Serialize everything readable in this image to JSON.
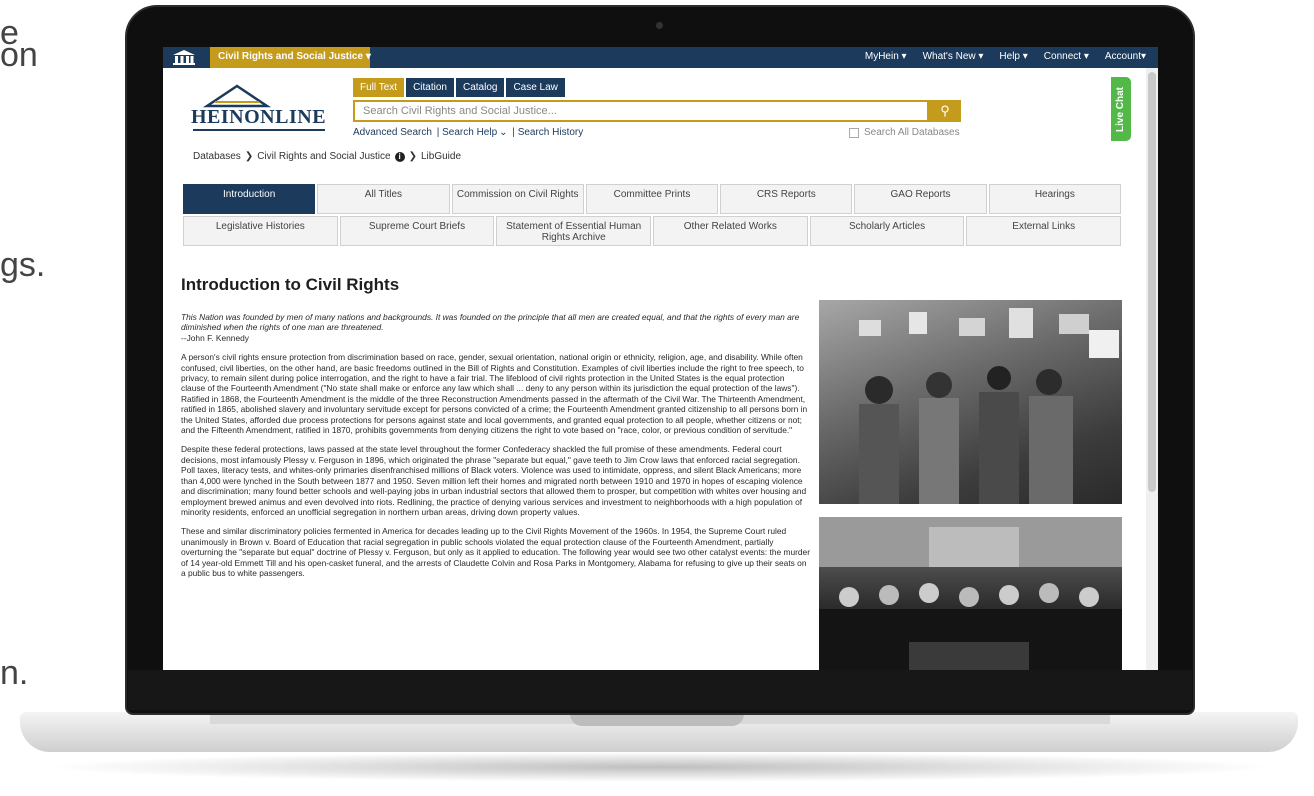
{
  "background_text": [
    "e",
    "on",
    "gs.",
    "n."
  ],
  "app": {
    "topbar": {
      "database_menu": "Civil Rights and Social Justice",
      "nav": [
        "MyHein ▾",
        "What's New ▾",
        "Help ▾",
        "Connect ▾",
        "Account▾"
      ]
    },
    "logo": "HEINONLINE",
    "search": {
      "tabs": [
        "Full Text",
        "Citation",
        "Catalog",
        "Case Law"
      ],
      "placeholder": "Search Civil Rights and Social Justice...",
      "advanced": "Advanced Search",
      "help": "Search Help",
      "history": "Search History",
      "all_databases": "Search All Databases"
    },
    "live_chat": "Live Chat",
    "breadcrumb": [
      "Databases",
      "Civil Rights and Social Justice",
      "LibGuide"
    ],
    "nav_buttons": {
      "row1": [
        "Introduction",
        "All Titles",
        "Commission on Civil Rights",
        "Committee Prints",
        "CRS Reports",
        "GAO Reports",
        "Hearings"
      ],
      "row2": [
        "Legislative Histories",
        "Supreme Court Briefs",
        "Statement of Essential Human Rights Archive",
        "Other Related Works",
        "Scholarly Articles",
        "External Links"
      ]
    },
    "page_title": "Introduction to Civil Rights",
    "quote": "This Nation was founded by men of many nations and backgrounds. It was founded on the principle that all men are created equal, and that the rights of every man are diminished when the rights of one man are threatened.",
    "quote_author": "--John F. Kennedy",
    "paragraph1": "A person's civil rights ensure protection from discrimination based on race, gender, sexual orientation, national origin or ethnicity, religion, age, and disability. While often confused, civil liberties, on the other hand, are basic freedoms outlined in the Bill of Rights and Constitution. Examples of civil liberties include the right to free speech, to privacy, to remain silent during police interrogation, and the right to have a fair trial. The lifeblood of civil rights protection in the United States is the equal protection clause of the Fourteenth Amendment (\"No state shall make or enforce any law which shall ... deny to any person within its jurisdiction the equal protection of the laws\"). Ratified in 1868, the Fourteenth Amendment is the middle of the three Reconstruction Amendments passed in the aftermath of the Civil War. The Thirteenth Amendment, ratified in 1865, abolished slavery and involuntary servitude except for persons convicted of a crime; the Fourteenth Amendment granted citizenship to all persons born in the United States, afforded due process protections for persons against state and local governments, and granted equal protection to all people, whether citizens or not; and the Fifteenth Amendment, ratified in 1870, prohibits governments from denying citizens the right to vote based on \"race, color, or previous condition of servitude.\"",
    "paragraph2": "Despite these federal protections, laws passed at the state level throughout the former Confederacy shackled the full promise of these amendments. Federal court decisions, most infamously Plessy v. Ferguson in 1896, which originated the phrase \"separate but equal,\" gave teeth to Jim Crow laws that enforced racial segregation. Poll taxes, literacy tests, and whites-only primaries disenfranchised millions of Black voters. Violence was used to intimidate, oppress, and silent Black Americans; more than 4,000 were lynched in the South between 1877 and 1950. Seven million left their homes and migrated north between 1910 and 1970 in hopes of escaping violence and discrimination; many found better schools and well-paying jobs in urban industrial sectors that allowed them to prosper, but competition with whites over housing and employment brewed animus and even devolved into riots. Redlining, the practice of denying various services and investment to neighborhoods with a high population of minority residents, enforced an unofficial segregation in northern urban areas, driving down property values.",
    "paragraph3": "These and similar discriminatory policies fermented in America for decades leading up to the Civil Rights Movement of the 1960s. In 1954, the Supreme Court ruled unanimously in Brown v. Board of Education that racial segregation in public schools violated the equal protection clause of the Fourteenth Amendment, partially overturning the \"separate but equal\" doctrine of Plessy v. Ferguson, but only as it applied to education. The following year would see two other catalyst events: the murder of 14 year-old Emmett Till and his open-casket funeral, and the arrests of Claudette Colvin and Rosa Parks in Montgomery, Alabama for refusing to give up their seats on a public bus to white passengers."
  }
}
